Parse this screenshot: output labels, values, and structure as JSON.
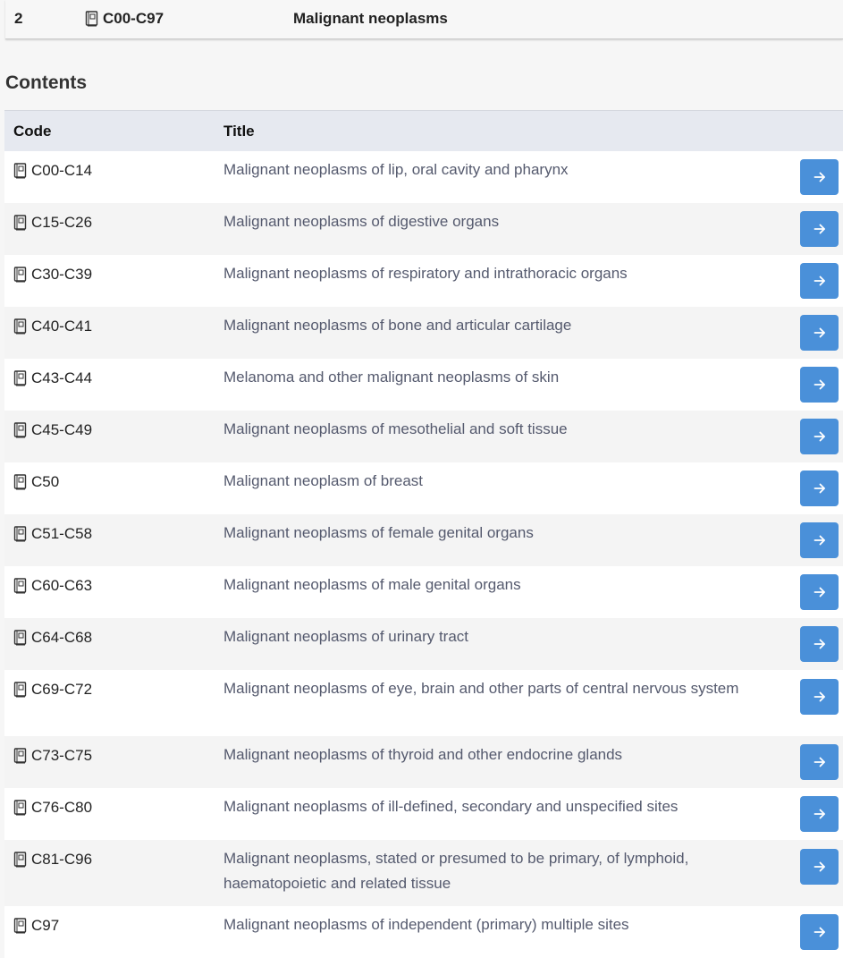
{
  "header": {
    "level": "2",
    "code": "C00-C97",
    "title": "Malignant neoplasms"
  },
  "contents_heading": "Contents",
  "table": {
    "columns": {
      "code": "Code",
      "title": "Title"
    },
    "rows": [
      {
        "code": "C00-C14",
        "title": "Malignant neoplasms of lip, oral cavity and pharynx"
      },
      {
        "code": "C15-C26",
        "title": "Malignant neoplasms of digestive organs"
      },
      {
        "code": "C30-C39",
        "title": "Malignant neoplasms of respiratory and intrathoracic organs"
      },
      {
        "code": "C40-C41",
        "title": "Malignant neoplasms of bone and articular cartilage"
      },
      {
        "code": "C43-C44",
        "title": "Melanoma and other malignant neoplasms of skin"
      },
      {
        "code": "C45-C49",
        "title": "Malignant neoplasms of mesothelial and soft tissue"
      },
      {
        "code": "C50",
        "title": "Malignant neoplasm of breast"
      },
      {
        "code": "C51-C58",
        "title": "Malignant neoplasms of female genital organs"
      },
      {
        "code": "C60-C63",
        "title": "Malignant neoplasms of male genital organs"
      },
      {
        "code": "C64-C68",
        "title": "Malignant neoplasms of urinary tract"
      },
      {
        "code": "C69-C72",
        "title": "Malignant neoplasms of eye, brain and other parts of central nervous system"
      },
      {
        "code": "C73-C75",
        "title": "Malignant neoplasms of thyroid and other endocrine glands"
      },
      {
        "code": "C76-C80",
        "title": "Malignant neoplasms of ill-defined, secondary and unspecified sites"
      },
      {
        "code": "C81-C96",
        "title": "Malignant neoplasms, stated or presumed to be primary, of lymphoid, haematopoietic and related tissue"
      },
      {
        "code": "C97",
        "title": "Malignant neoplasms of independent (primary) multiple sites"
      }
    ]
  },
  "icons": {
    "code_icon": "book-icon",
    "row_button_icon": "arrow-right-icon"
  },
  "colors": {
    "button": "#4a90d9",
    "title_text": "#555a6e",
    "header_row": "#e6e9f0"
  }
}
